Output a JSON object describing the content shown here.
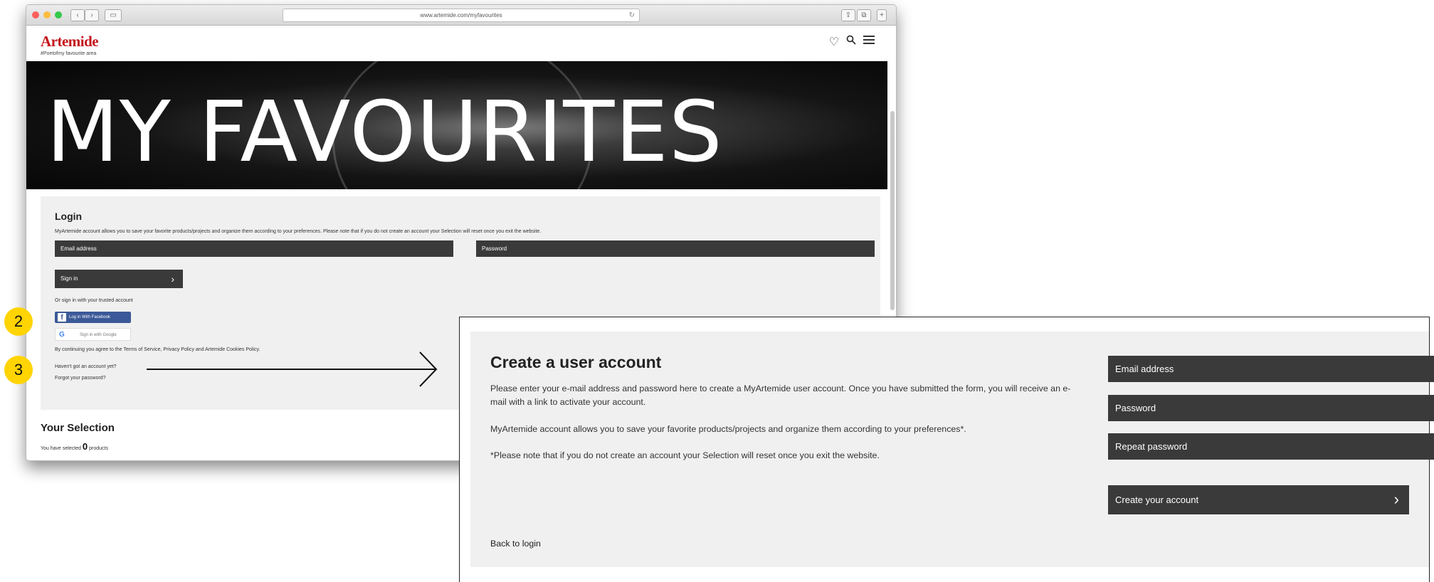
{
  "browser": {
    "url": "www.artemide.com/myfavourites",
    "traffic_colors": [
      "#fc605c",
      "#fdbc40",
      "#34c84a"
    ]
  },
  "header": {
    "logo": "Artemide",
    "logo_sub": "#Poetofmy favourite area",
    "icons": [
      "heart-icon",
      "search-icon",
      "menu-icon"
    ]
  },
  "hero": {
    "title": "MY FAVOURITES"
  },
  "login": {
    "title": "Login",
    "description": "MyArtemide account allows you to save your favorite products/projects and organize them according to your preferences. Please note that if you do not create an account your Selection will reset once you exit the website.",
    "email_label": "Email address",
    "password_label": "Password",
    "signin_label": "Sign in",
    "trusted_text": "Or sign in with your trusted account",
    "facebook_label": "Log in With Facebook",
    "google_label": "Sign in with Google",
    "terms_text": "By continuing you agree to the Terms of Service, Privacy Policy and Artemide Cookies Policy.",
    "no_account": "Haven't got an account yet?",
    "forgot": "Forgot your password?"
  },
  "selection": {
    "title": "Your Selection",
    "prefix": "You have selected",
    "count": "0",
    "suffix": "products"
  },
  "annotations": {
    "badge_2": "2",
    "badge_3": "3",
    "badge_color": "#ffd400"
  },
  "create_account": {
    "title": "Create a user account",
    "para1": "Please enter your e-mail address and password here to create a MyArtemide user account. Once you have submitted the form, you will receive an e-mail with a link to activate your account.",
    "para2": "MyArtemide account allows you to save your favorite products/projects and organize them according to your preferences*.",
    "para3": "*Please note that if you do not create an account your Selection will reset once you exit the website.",
    "email_label": "Email address",
    "password_label": "Password",
    "repeat_label": "Repeat password",
    "submit_label": "Create your account",
    "back_label": "Back to login"
  }
}
